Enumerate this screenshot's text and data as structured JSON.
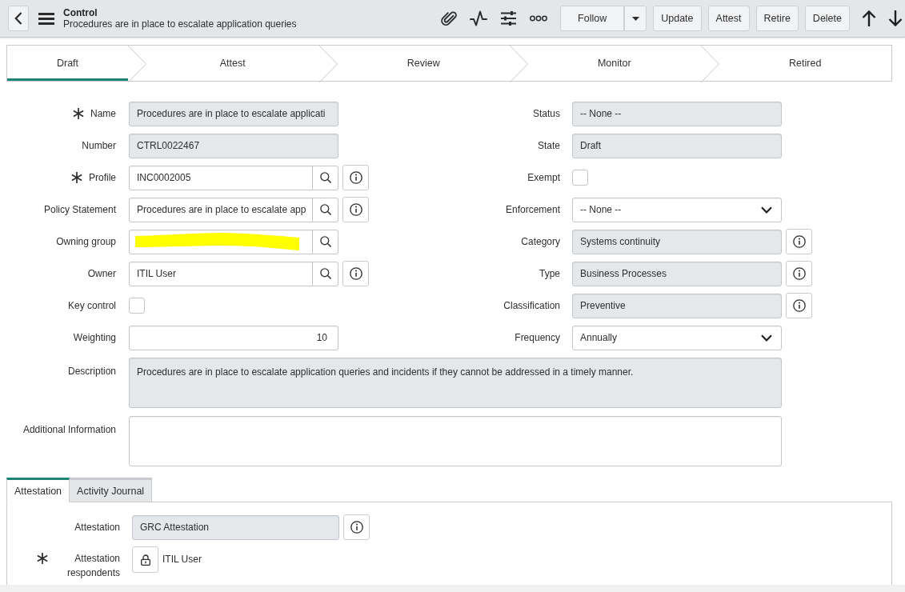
{
  "header": {
    "title": "Control",
    "subtitle": "Procedures are in place to escalate application queries",
    "follow": "Follow",
    "actions": [
      "Update",
      "Attest",
      "Retire",
      "Delete"
    ]
  },
  "stages": [
    {
      "label": "Draft",
      "selected": true
    },
    {
      "label": "Attest",
      "selected": false
    },
    {
      "label": "Review",
      "selected": false
    },
    {
      "label": "Monitor",
      "selected": false
    },
    {
      "label": "Retired",
      "selected": false
    }
  ],
  "form": {
    "left": [
      {
        "label": "Name",
        "kind": "readonly",
        "value": "Procedures are in place to escalate applicati",
        "required": true,
        "info": false
      },
      {
        "label": "Number",
        "kind": "readonly",
        "value": "CTRL0022467",
        "required": false,
        "info": false
      },
      {
        "label": "Profile",
        "kind": "lookup",
        "value": "INC0002005",
        "required": true,
        "info": true,
        "redacted": false
      },
      {
        "label": "Policy Statement",
        "kind": "lookup",
        "value": "Procedures are in place to escalate app",
        "required": false,
        "info": true,
        "redacted": false
      },
      {
        "label": "Owning group",
        "kind": "lookup",
        "required": false,
        "info": false,
        "redacted": true
      },
      {
        "label": "Owner",
        "kind": "lookup",
        "value": "ITIL User",
        "required": false,
        "info": true,
        "redacted": false
      },
      {
        "label": "Key control",
        "kind": "checkbox",
        "checked": false,
        "required": false,
        "info": false
      },
      {
        "label": "Weighting",
        "kind": "number",
        "value": "10",
        "required": false,
        "info": false
      }
    ],
    "right": [
      {
        "label": "Status",
        "kind": "readonly",
        "value": "-- None --",
        "required": false,
        "info": false
      },
      {
        "label": "State",
        "kind": "readonly",
        "value": "Draft",
        "required": false,
        "info": false
      },
      {
        "label": "Exempt",
        "kind": "checkbox",
        "checked": false,
        "required": false,
        "info": false
      },
      {
        "label": "Enforcement",
        "kind": "select",
        "value": "-- None --",
        "required": false,
        "info": false
      },
      {
        "label": "Category",
        "kind": "readonly",
        "value": "Systems continuity",
        "required": false,
        "info": true
      },
      {
        "label": "Type",
        "kind": "readonly",
        "value": "Business Processes",
        "required": false,
        "info": true
      },
      {
        "label": "Classification",
        "kind": "readonly",
        "value": "Preventive",
        "required": false,
        "info": true
      },
      {
        "label": "Frequency",
        "kind": "select",
        "value": "Annually",
        "required": false,
        "info": false
      }
    ],
    "wide": [
      {
        "label": "Description",
        "kind": "textarea",
        "readonly": true,
        "value": "Procedures are in place to escalate application queries and incidents if they cannot be addressed in a timely manner.",
        "required": false,
        "info": false
      },
      {
        "label": "Additional Information",
        "kind": "textarea",
        "readonly": false,
        "required": false,
        "info": false
      }
    ]
  },
  "section_tabs": [
    {
      "label": "Attestation",
      "selected": true
    },
    {
      "label": "Activity Journal",
      "selected": false
    }
  ],
  "attestation": {
    "fields": [
      {
        "label": "Attestation",
        "kind": "readonly",
        "value": "GRC Attestation",
        "required": false,
        "info": true
      },
      {
        "label": "Attestation respondents",
        "kind": "locked_list",
        "value": "ITIL User",
        "required": true,
        "info": false
      }
    ]
  }
}
